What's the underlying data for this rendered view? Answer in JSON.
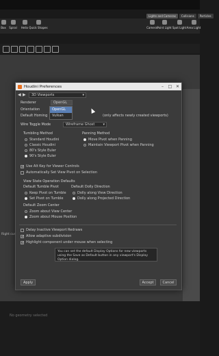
{
  "shelf": {
    "tabs": [
      "Lights and Cameras",
      "Collisions",
      "Particles"
    ],
    "left_tools": [
      "Box",
      "Spiral",
      "Helix",
      "Quick Shapes"
    ],
    "right_tools": [
      "Camera",
      "Point Light",
      "Spot Light",
      "Area Light"
    ]
  },
  "viewport": {
    "left_text": "Right cursor",
    "status_text": "No geometry selected"
  },
  "dialog": {
    "title": "Houdini Preferences",
    "category": "3D Viewports",
    "renderer_label": "Renderer",
    "renderer_value": "OpenGL",
    "renderer_options": [
      "OpenGL",
      "Vulkan"
    ],
    "orientation_label": "Orientation",
    "default_homing_label": "Default Homing",
    "default_homing_note": "(only affects newly created viewports)",
    "wire_toggle_label": "Wire Toggle Mode",
    "wire_toggle_value": "Wireframe Ghost",
    "tumbling_title": "Tumbling Method",
    "tumbling_options": [
      "Standard Houdini",
      "Classic Houdini",
      "80's Style Euler",
      "90's Style Euler"
    ],
    "panning_title": "Panning Method",
    "panning_options": [
      "Move Pivot when Panning",
      "Maintain Viewport Pivot when Panning"
    ],
    "use_alt_key": "Use Alt Key for Viewer Controls",
    "auto_set_pivot": "Automatically Set View Pivot on Selection",
    "view_state_title": "View State Operation Defaults",
    "default_tumble_pivot_title": "Default Tumble Pivot",
    "tumble_pivot_options": [
      "Keep Pivot on Tumble",
      "Set Pivot on Tumble"
    ],
    "default_dolly_title": "Default Dolly Direction",
    "dolly_options": [
      "Dolly along View Direction",
      "Dolly along Projected Direction"
    ],
    "default_zoom_title": "Default Zoom Center",
    "zoom_options": [
      "Zoom about View Center",
      "Zoom about Mouse Position"
    ],
    "delay_redraws": "Delay Inactive Viewport Redraws",
    "adaptive_subdivision": "Allow adaptive subdivision",
    "highlight_component": "Highlight component under mouse when selecting",
    "tooltip": "You can set the default Display Options for new viewports using the Save as Default button in any viewport's Display Option dialog.",
    "apply": "Apply",
    "accept": "Accept",
    "cancel": "Cancel"
  }
}
